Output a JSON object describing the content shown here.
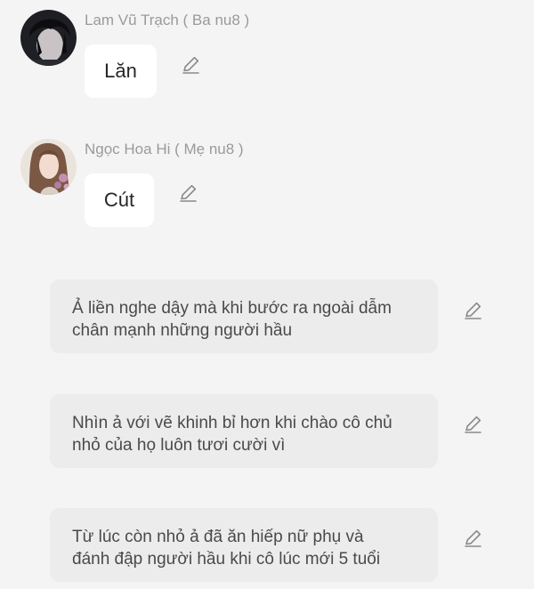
{
  "messages": [
    {
      "sender": "Lam Vũ Trạch ( Ba nu8 )",
      "text": "Lăn",
      "avatar_icon": "dark-haired-man-avatar"
    },
    {
      "sender": "Ngọc Hoa Hi ( Mẹ nu8 )",
      "text": "Cút",
      "avatar_icon": "woman-with-flowers-avatar"
    }
  ],
  "narrations": [
    {
      "line1": "Ả liền nghe dậy mà khi bước ra ngoài dẫm",
      "line2": "chân mạnh những người hầu"
    },
    {
      "line1": "Nhìn ả với vẽ khinh bỉ hơn khi chào cô chủ",
      "line2": "nhỏ của họ luôn tươi cười vì"
    },
    {
      "line1": "Từ lúc còn nhỏ ả đã ăn hiếp nữ phụ và",
      "line2": "đánh đập người hầu khi cô lúc mới 5 tuổi"
    }
  ],
  "icons": {
    "edit": "pencil-edit-icon"
  },
  "colors": {
    "background": "#f4f4f4",
    "bubble": "#ffffff",
    "narration_box": "#ececec",
    "sender_text": "#9a9a9a",
    "icon": "#8a8a8a"
  }
}
